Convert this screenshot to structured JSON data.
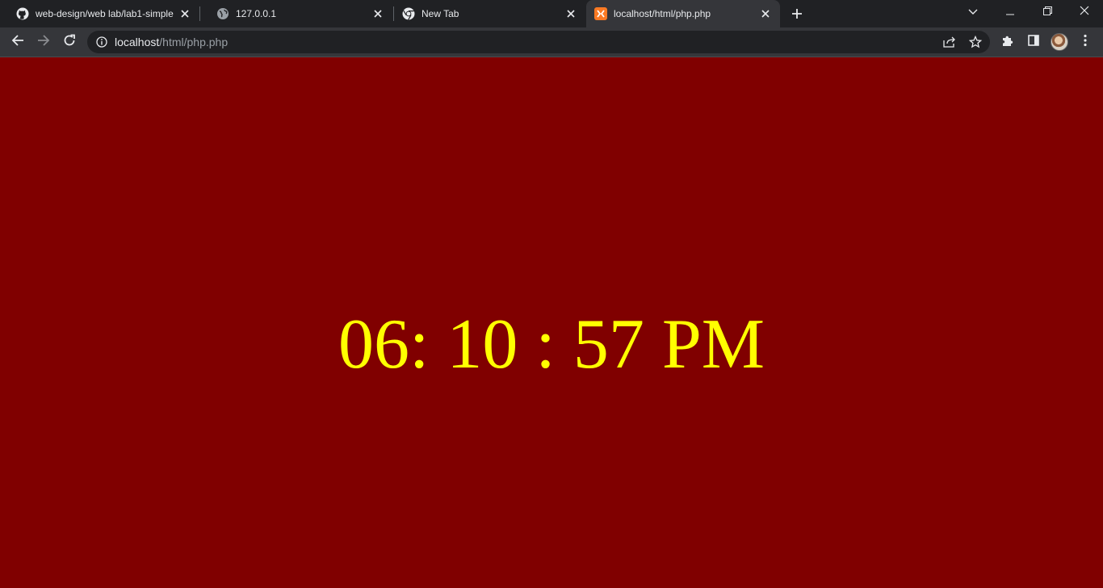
{
  "browser": {
    "tabs": [
      {
        "title": "web-design/web lab/lab1-simple",
        "favicon": "github-icon",
        "active": false
      },
      {
        "title": "127.0.0.1",
        "favicon": "globe-icon",
        "active": false
      },
      {
        "title": "New Tab",
        "favicon": "chrome-icon",
        "active": false
      },
      {
        "title": "localhost/html/php.php",
        "favicon": "xampp-icon",
        "active": true
      }
    ],
    "address": {
      "host": "localhost",
      "path": "/html/php.php"
    },
    "colors": {
      "tabstrip": "#202124",
      "toolbar": "#35363a",
      "omnibox": "#202124"
    }
  },
  "page": {
    "clock_text": "06: 10 : 57 PM",
    "background_color": "#800000",
    "clock_color": "#ffff00"
  }
}
